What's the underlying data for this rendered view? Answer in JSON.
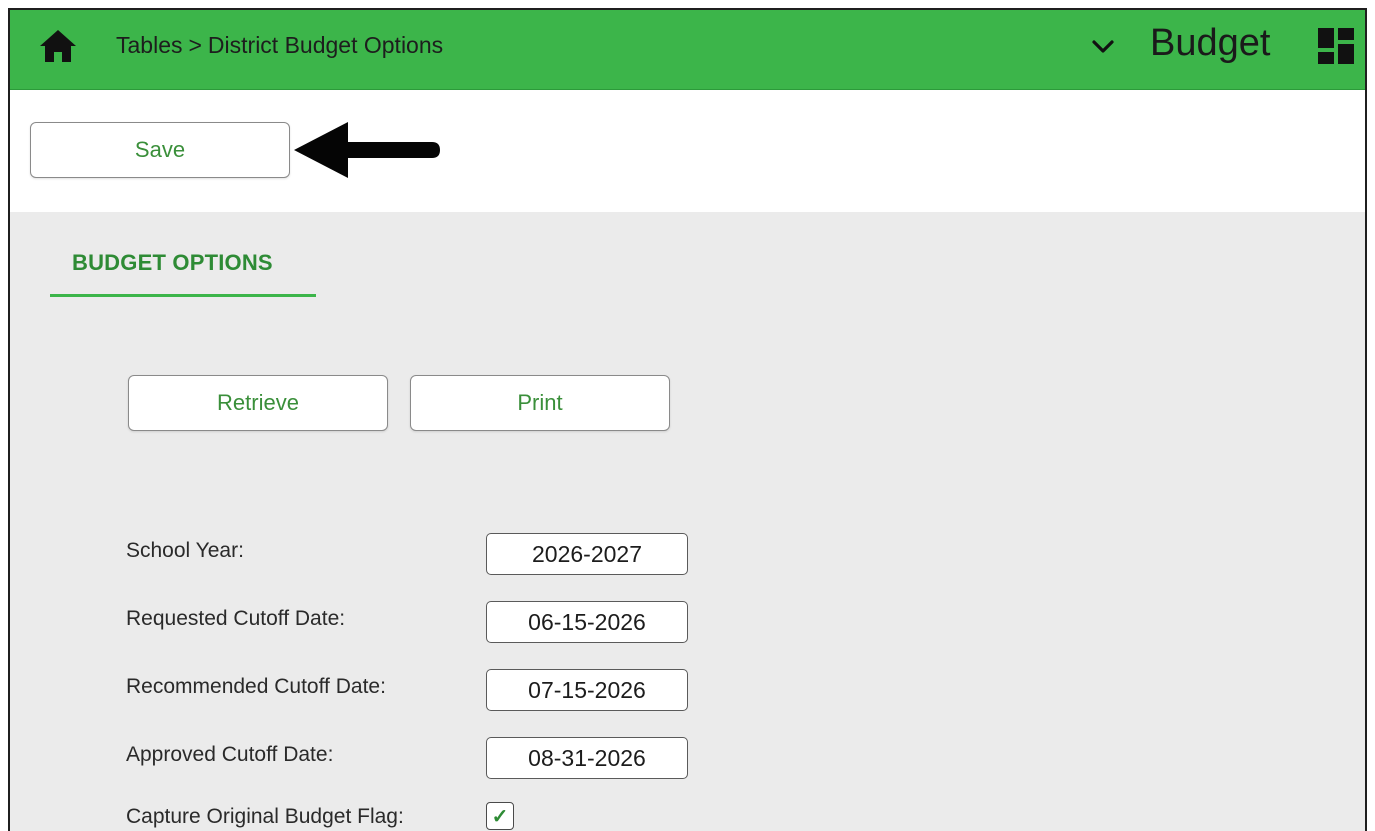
{
  "header": {
    "breadcrumb": {
      "parent": "Tables",
      "separator": ">",
      "current": "District Budget Options"
    },
    "module_title": "Budget",
    "icons": {
      "home": "home-icon",
      "menu_toggle": "chevron-down-icon",
      "dashboard": "dashboard-grid-icon"
    },
    "colors": {
      "bar": "#3cb54a",
      "accent_text": "#2e8b35"
    }
  },
  "toolbar": {
    "save_label": "Save"
  },
  "tabs": [
    {
      "label": "BUDGET OPTIONS",
      "active": true
    }
  ],
  "actions": {
    "retrieve_label": "Retrieve",
    "print_label": "Print"
  },
  "form": {
    "fields": [
      {
        "label": "School Year:",
        "value": "2026-2027"
      },
      {
        "label": "Requested Cutoff Date:",
        "value": "06-15-2026"
      },
      {
        "label": "Recommended Cutoff Date:",
        "value": "07-15-2026"
      },
      {
        "label": "Approved Cutoff Date:",
        "value": "08-31-2026"
      }
    ],
    "capture_flag": {
      "label": "Capture Original Budget Flag:",
      "checked": true,
      "mark": "✓"
    }
  }
}
